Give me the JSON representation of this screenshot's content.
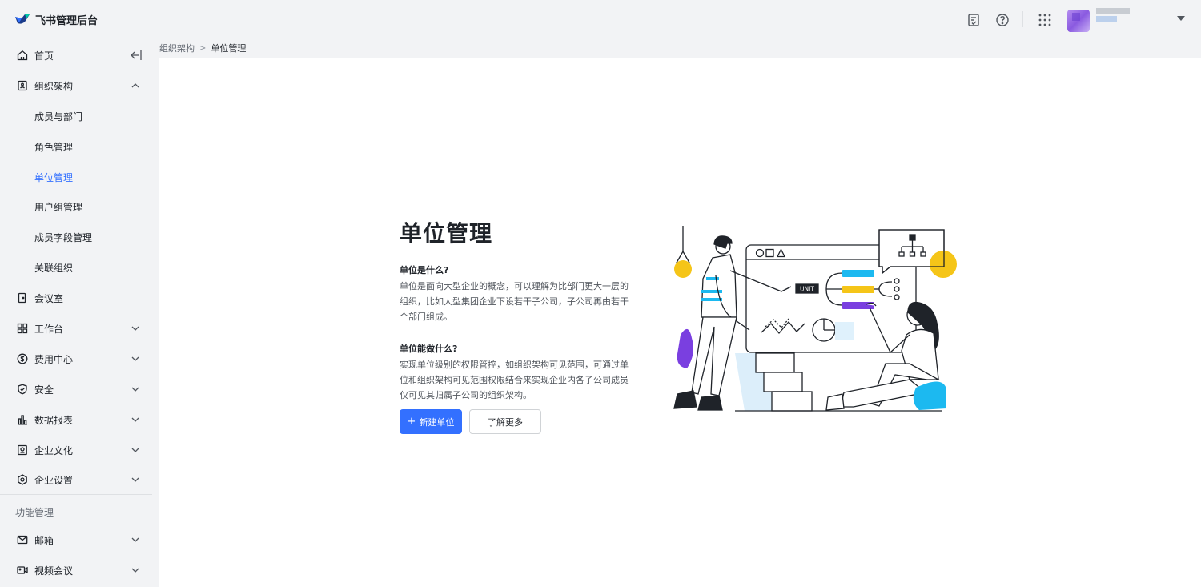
{
  "header": {
    "brand": "飞书管理后台",
    "icons": [
      "document-check-icon",
      "help-icon",
      "apps-grid-icon",
      "avatar",
      "dropdown-caret-icon"
    ]
  },
  "sidebar": {
    "items": [
      {
        "label": "首页",
        "icon": "home-icon"
      },
      {
        "label": "组织架构",
        "icon": "org-icon",
        "expanded": true
      },
      {
        "label": "成员与部门"
      },
      {
        "label": "角色管理"
      },
      {
        "label": "单位管理",
        "active": true
      },
      {
        "label": "用户组管理"
      },
      {
        "label": "成员字段管理"
      },
      {
        "label": "关联组织"
      },
      {
        "label": "会议室",
        "icon": "meeting-room-icon"
      },
      {
        "label": "工作台",
        "icon": "workbench-icon"
      },
      {
        "label": "费用中心",
        "icon": "billing-icon"
      },
      {
        "label": "安全",
        "icon": "shield-icon"
      },
      {
        "label": "数据报表",
        "icon": "bar-chart-icon"
      },
      {
        "label": "企业文化",
        "icon": "culture-icon"
      },
      {
        "label": "企业设置",
        "icon": "settings-icon"
      }
    ],
    "section_label": "功能管理",
    "section_items": [
      {
        "label": "邮箱",
        "icon": "mail-icon"
      },
      {
        "label": "视频会议",
        "icon": "video-icon"
      }
    ]
  },
  "breadcrumb": {
    "parent": "组织架构",
    "separator": ">",
    "current": "单位管理"
  },
  "main": {
    "title": "单位管理",
    "q1": "单位是什么?",
    "a1": "单位是面向大型企业的概念，可以理解为比部门更大一层的组织，比如大型集团企业下设若干子公司，子公司再由若干个部门组成。",
    "q2": "单位能做什么?",
    "a2": "实现单位级别的权限管控，如组织架构可见范围，可通过单位和组织架构可见范围权限结合来实现企业内各子公司成员仅可见其归属子公司的组织架构。",
    "primary_button": "新建单位",
    "secondary_button": "了解更多",
    "illustration_label": "UNIT"
  },
  "colors": {
    "accent": "#3370ff",
    "yellow": "#f5c518",
    "cyan": "#1cb9f0",
    "purple": "#7a3fe0"
  }
}
